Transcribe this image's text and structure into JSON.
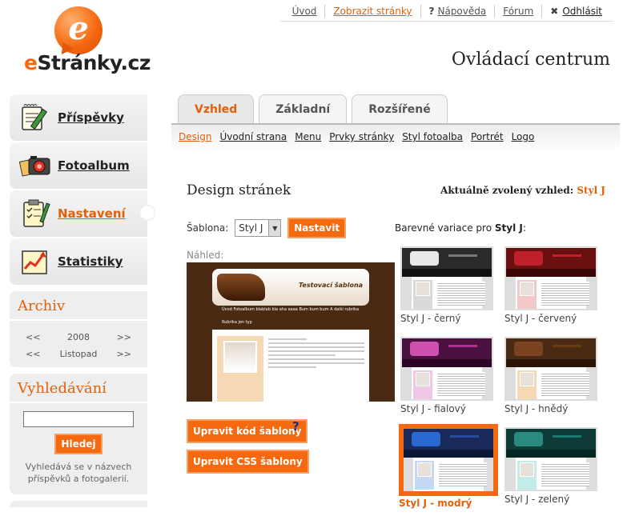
{
  "logo": {
    "e": "e",
    "word_prefix": "e",
    "word_rest": "Stránky.cz"
  },
  "topnav": {
    "uvod": "Úvod",
    "zobrazit": "Zobrazit stránky",
    "napoveda": "Nápověda",
    "forum": "Fórum",
    "odhlasit": "Odhlásit"
  },
  "page_title": "Ovládací centrum",
  "sidebar": {
    "items": [
      {
        "label": "Příspěvky",
        "icon": "notepad-pencil-icon"
      },
      {
        "label": "Fotoalbum",
        "icon": "photo-camera-icon"
      },
      {
        "label": "Nastavení",
        "icon": "clipboard-checklist-icon"
      },
      {
        "label": "Statistiky",
        "icon": "chart-arrow-icon"
      }
    ]
  },
  "archive": {
    "title": "Archiv",
    "prev": "<<",
    "next": ">>",
    "year": "2008",
    "month": "Listopad"
  },
  "search": {
    "title": "Vyhledávání",
    "value": "",
    "button": "Hledej",
    "note": "Vyhledává se v názvech příspěvků a fotogalerií."
  },
  "tabs": [
    "Vzhled",
    "Základní",
    "Rozšířené"
  ],
  "subnav": [
    "Design",
    "Úvodní strana",
    "Menu",
    "Prvky stránky",
    "Styl fotoalba",
    "Portrét",
    "Logo"
  ],
  "main": {
    "section_title": "Design stránek",
    "current_label": "Aktuálně zvolený vzhled:",
    "current_value": "Styl J",
    "template_label": "Šablona:",
    "template_value": "Styl J",
    "set_button": "Nastavit",
    "variants_label_prefix": "Barevné variace pro",
    "variants_label_name": "Styl J",
    "variants_label_suffix": ":",
    "preview_label": "Náhled:",
    "preview_site_title": "Testovací šablona",
    "preview_menu": "Úvod    Fotoalbum    blablab bla    aha aaaa    Bum bum bum    A další rubrika",
    "preview_sub": "Rubrika jen typ",
    "edit_code_button": "Upravit kód šablony",
    "edit_css_button": "Upravit CSS šablony",
    "help": "?"
  },
  "variants": [
    {
      "name": "Styl J - černý",
      "head": "#2a2a2a",
      "obj": "#e8e8e8",
      "band": "#111111",
      "side": "#d9d9d9",
      "title": "#777777"
    },
    {
      "name": "Styl J - červený",
      "head": "#6a1010",
      "obj": "#c0202a",
      "band": "#3a0606",
      "side": "#f2c8c8",
      "title": "#c0202a"
    },
    {
      "name": "Styl J - fialový",
      "head": "#4a1040",
      "obj": "#d050b0",
      "band": "#2a0624",
      "side": "#f0c8e6",
      "title": "#b03090"
    },
    {
      "name": "Styl J - hnědý",
      "head": "#4a2a12",
      "obj": "#7a4220",
      "band": "#2a1406",
      "side": "#f5d9b4",
      "title": "#6a3a10"
    },
    {
      "name": "Styl J - modrý",
      "head": "#1a2a5a",
      "obj": "#2a6ad0",
      "band": "#0c1636",
      "side": "#c8d8f4",
      "title": "#2a4aa0",
      "selected": true
    },
    {
      "name": "Styl J - zelený",
      "head": "#0e3a38",
      "obj": "#2a8a80",
      "band": "#062624",
      "side": "#c4ece6",
      "title": "#1a7a70"
    }
  ]
}
